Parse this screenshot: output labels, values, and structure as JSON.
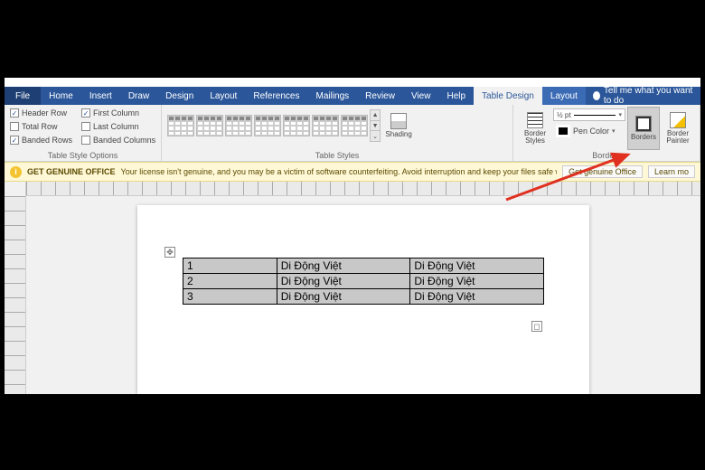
{
  "tabs": {
    "file": "File",
    "home": "Home",
    "insert": "Insert",
    "draw": "Draw",
    "design": "Design",
    "layout": "Layout",
    "references": "References",
    "mailings": "Mailings",
    "review": "Review",
    "view": "View",
    "help": "Help",
    "table_design": "Table Design",
    "ctx_layout": "Layout",
    "tell_me": "Tell me what you want to do"
  },
  "ribbon": {
    "opts": {
      "header_row": "Header Row",
      "total_row": "Total Row",
      "banded_rows": "Banded Rows",
      "first_col": "First Column",
      "last_col": "Last Column",
      "banded_cols": "Banded Columns",
      "label": "Table Style Options"
    },
    "styles_label": "Table Styles",
    "shading": "Shading",
    "border_styles": "Border\nStyles",
    "pen_weight": "½ pt",
    "pen_color": "Pen Color",
    "borders_label": "Borders",
    "borders_btn": "Borders",
    "border_painter": "Border\nPainter"
  },
  "msg": {
    "title": "GET GENUINE OFFICE",
    "body": "Your license isn't genuine, and you may be a victim of software counterfeiting. Avoid interruption and keep your files safe with genuine Office today.",
    "btn": "Get genuine Office",
    "learn": "Learn mo"
  },
  "table": {
    "rows": [
      [
        "1",
        "Di Động Việt",
        "Di Động Việt"
      ],
      [
        "2",
        "Di Động Việt",
        "Di Động Việt"
      ],
      [
        "3",
        "Di Động Việt",
        "Di Động Việt"
      ]
    ]
  }
}
